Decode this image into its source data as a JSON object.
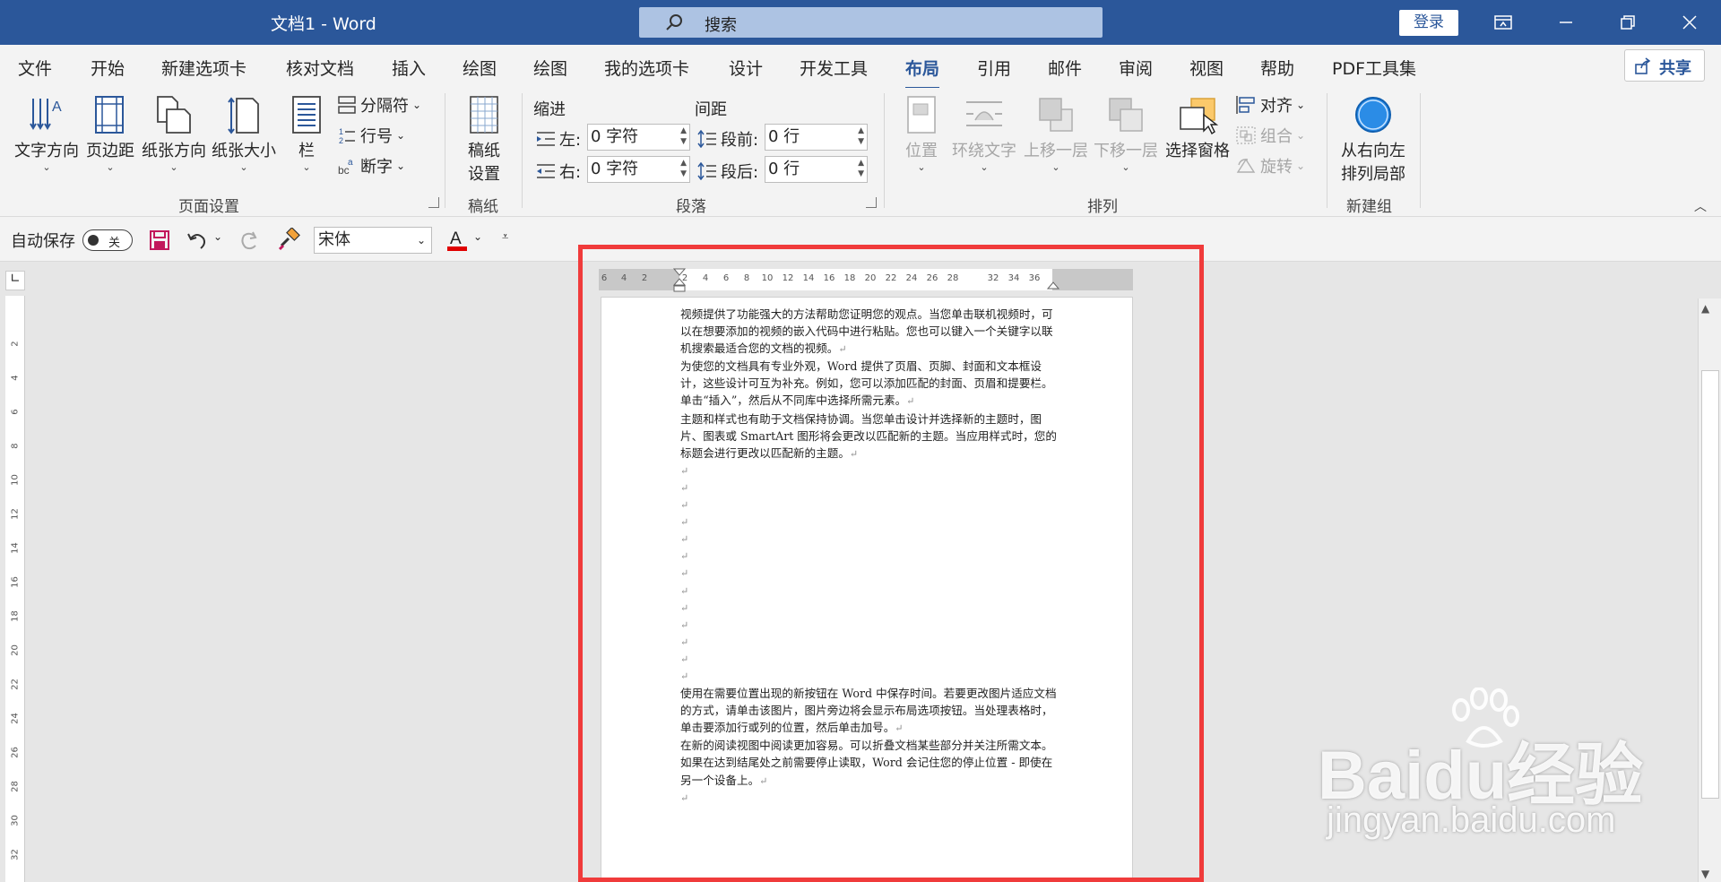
{
  "window": {
    "title": "文档1  -  Word",
    "search_placeholder": "搜索",
    "login_label": "登录"
  },
  "ribbon_tabs": [
    "文件",
    "开始",
    "新建选项卡",
    "核对文档",
    "插入",
    "绘图",
    "绘图",
    "我的选项卡",
    "设计",
    "开发工具",
    "布局",
    "引用",
    "邮件",
    "审阅",
    "视图",
    "帮助",
    "PDF工具集"
  ],
  "active_tab": "布局",
  "share_label": "共享",
  "page_setup": {
    "text_direction": "文字方向",
    "margins": "页边距",
    "orientation": "纸张方向",
    "size": "纸张大小",
    "columns": "栏",
    "breaks": "分隔符",
    "line_numbers": "行号",
    "hyphenation": "断字",
    "group_label": "页面设置"
  },
  "manuscript": {
    "button": "稿纸\n设置",
    "btn_line1": "稿纸",
    "btn_line2": "设置",
    "group_label": "稿纸"
  },
  "paragraph": {
    "indent_label": "缩进",
    "spacing_label": "间距",
    "left_label": "左:",
    "right_label": "右:",
    "before_label": "段前:",
    "after_label": "段后:",
    "left_value": "0 字符",
    "right_value": "0 字符",
    "before_value": "0 行",
    "after_value": "0 行",
    "group_label": "段落"
  },
  "arrange": {
    "position": "位置",
    "wrap_text": "环绕文字",
    "bring_forward": "上移一层",
    "send_backward": "下移一层",
    "selection_pane": "选择窗格",
    "align": "对齐",
    "group": "组合",
    "rotate": "旋转",
    "group_label": "排列"
  },
  "new_group": {
    "button_line1": "从右向左",
    "button_line2": "排列局部",
    "group_label": "新建组"
  },
  "qat": {
    "autosave_label": "自动保存",
    "autosave_state": "关",
    "font_name": "宋体"
  },
  "hruler_ticks": [
    "6",
    "4",
    "2",
    "2",
    "4",
    "6",
    "8",
    "10",
    "12",
    "14",
    "16",
    "18",
    "20",
    "22",
    "24",
    "26",
    "28",
    "32",
    "34",
    "36"
  ],
  "vruler_ticks": [
    "2",
    "4",
    "6",
    "8",
    "10",
    "12",
    "14",
    "16",
    "18",
    "20",
    "22",
    "24",
    "26",
    "28",
    "30",
    "32"
  ],
  "document": {
    "p1": "视频提供了功能强大的方法帮助您证明您的观点。当您单击联机视频时，可以在想要添加的视频的嵌入代码中进行粘贴。您也可以键入一个关键字以联机搜索最适合您的文档的视频。",
    "p2": "为使您的文档具有专业外观，Word 提供了页眉、页脚、封面和文本框设计，这些设计可互为补充。例如，您可以添加匹配的封面、页眉和提要栏。单击“插入”，然后从不同库中选择所需元素。",
    "p3": "主题和样式也有助于文档保持协调。当您单击设计并选择新的主题时，图片、图表或 SmartArt 图形将会更改以匹配新的主题。当应用样式时，您的标题会进行更改以匹配新的主题。",
    "p4": "使用在需要位置出现的新按钮在 Word 中保存时间。若要更改图片适应文档的方式，请单击该图片，图片旁边将会显示布局选项按钮。当处理表格时，单击要添加行或列的位置，然后单击加号。",
    "p5": "在新的阅读视图中阅读更加容易。可以折叠文档某些部分并关注所需文本。如果在达到结尾处之前需要停止读取，Word 会记住您的停止位置 - 即使在另一个设备上。",
    "para_mark": "↵"
  },
  "watermark": {
    "brand": "Baidu经验",
    "url": "jingyan.baidu.com"
  },
  "colors": {
    "title_bar": "#2b579a",
    "highlight_box": "#f03b3b",
    "save_icon": "#c2185b",
    "font_color_bar": "#e00000"
  }
}
